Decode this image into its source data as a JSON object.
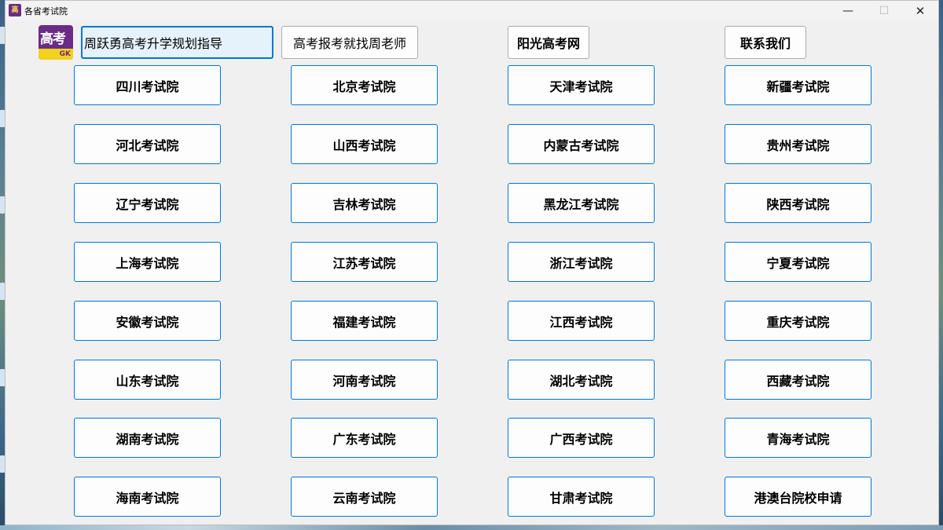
{
  "window": {
    "title": "各省考试院"
  },
  "logo": {
    "text": "高考",
    "badge": "GK"
  },
  "top_buttons": {
    "guide": "周跃勇高考升学规划指导",
    "apply": "高考报考就找周老师",
    "sunshine": "阳光高考网",
    "contact": "联系我们"
  },
  "provinces": [
    "四川考试院",
    "北京考试院",
    "天津考试院",
    "新疆考试院",
    "河北考试院",
    "山西考试院",
    "内蒙古考试院",
    "贵州考试院",
    "辽宁考试院",
    "吉林考试院",
    "黑龙江考试院",
    "陕西考试院",
    "上海考试院",
    "江苏考试院",
    "浙江考试院",
    "宁夏考试院",
    "安徽考试院",
    "福建考试院",
    "江西考试院",
    "重庆考试院",
    "山东考试院",
    "河南考试院",
    "湖北考试院",
    "西藏考试院",
    "湖南考试院",
    "广东考试院",
    "广西考试院",
    "青海考试院",
    "海南考试院",
    "云南考试院",
    "甘肃考试院",
    "港澳台院校申请"
  ],
  "icons": {
    "app": "app-logo-icon",
    "minimize": "minimize-icon",
    "maximize": "maximize-icon",
    "close": "close-icon"
  },
  "colors": {
    "accent": "#0078d4",
    "logo_purple": "#6b2c86",
    "logo_yellow": "#f2d21c"
  }
}
